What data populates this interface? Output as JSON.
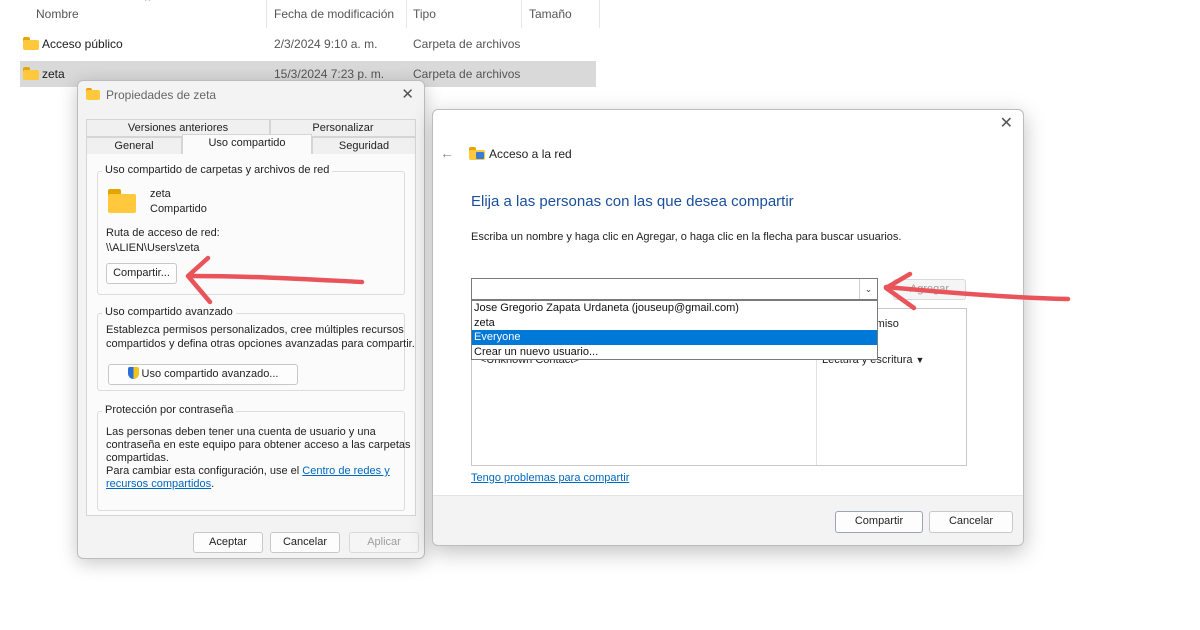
{
  "explorer": {
    "columns": [
      "Nombre",
      "Fecha de modificación",
      "Tipo",
      "Tamaño"
    ],
    "files": [
      {
        "name": "Acceso público",
        "date": "2/3/2024 9:10 a. m.",
        "type": "Carpeta de archivos"
      },
      {
        "name": "zeta",
        "date": "15/3/2024 7:23 p. m.",
        "type": "Carpeta de archivos"
      }
    ]
  },
  "props": {
    "title": "Propiedades de zeta",
    "tabs_top": [
      "Versiones anteriores",
      "Personalizar"
    ],
    "tabs_bottom": [
      "General",
      "Uso compartido",
      "Seguridad"
    ],
    "sharing_group": "Uso compartido de carpetas y archivos de red",
    "folder_name": "zeta",
    "folder_status": "Compartido",
    "network_path_label": "Ruta de acceso de red:",
    "network_path": "\\\\ALIEN\\Users\\zeta",
    "share_button": "Compartir...",
    "advanced_group": "Uso compartido avanzado",
    "advanced_text_1": "Establezca permisos personalizados, cree múltiples recursos",
    "advanced_text_2": "compartidos y defina otras opciones avanzadas para compartir.",
    "advanced_button": "Uso compartido avanzado...",
    "password_group": "Protección por contraseña",
    "password_text_1": "Las personas deben tener una cuenta de usuario y una",
    "password_text_2": "contraseña en este equipo para obtener acceso a las carpetas",
    "password_text_3": "compartidas.",
    "password_text_4": "Para cambiar esta configuración, use el ",
    "password_link_1": "Centro de redes y",
    "password_link_2": "recursos compartidos",
    "password_text_5": ".",
    "ok": "Aceptar",
    "cancel": "Cancelar",
    "apply": "Aplicar"
  },
  "net": {
    "title": "Acceso a la red",
    "heading": "Elija a las personas con las que desea compartir",
    "instructions": "Escriba un nombre y haga clic en Agregar, o haga clic en la flecha para buscar usuarios.",
    "input_value": "",
    "add_button": "Agregar",
    "dropdown_options": [
      "Jose Gregorio Zapata Urdaneta (jouseup@gmail.com)",
      "zeta",
      "Everyone",
      "Crear un nuevo usuario..."
    ],
    "selected_option": "Everyone",
    "permission_header_partial": "rmiso",
    "list_row_name_partial": "<Unknown Contact>",
    "list_row_permission": "Lectura y escritura",
    "trouble_link": "Tengo problemas para compartir",
    "share_button": "Compartir",
    "cancel_button": "Cancelar"
  },
  "colors": {
    "annotation_arrow": "#e8545a",
    "selection": "#0078d7",
    "link": "#0067c0",
    "folder": "#ffc83d"
  }
}
